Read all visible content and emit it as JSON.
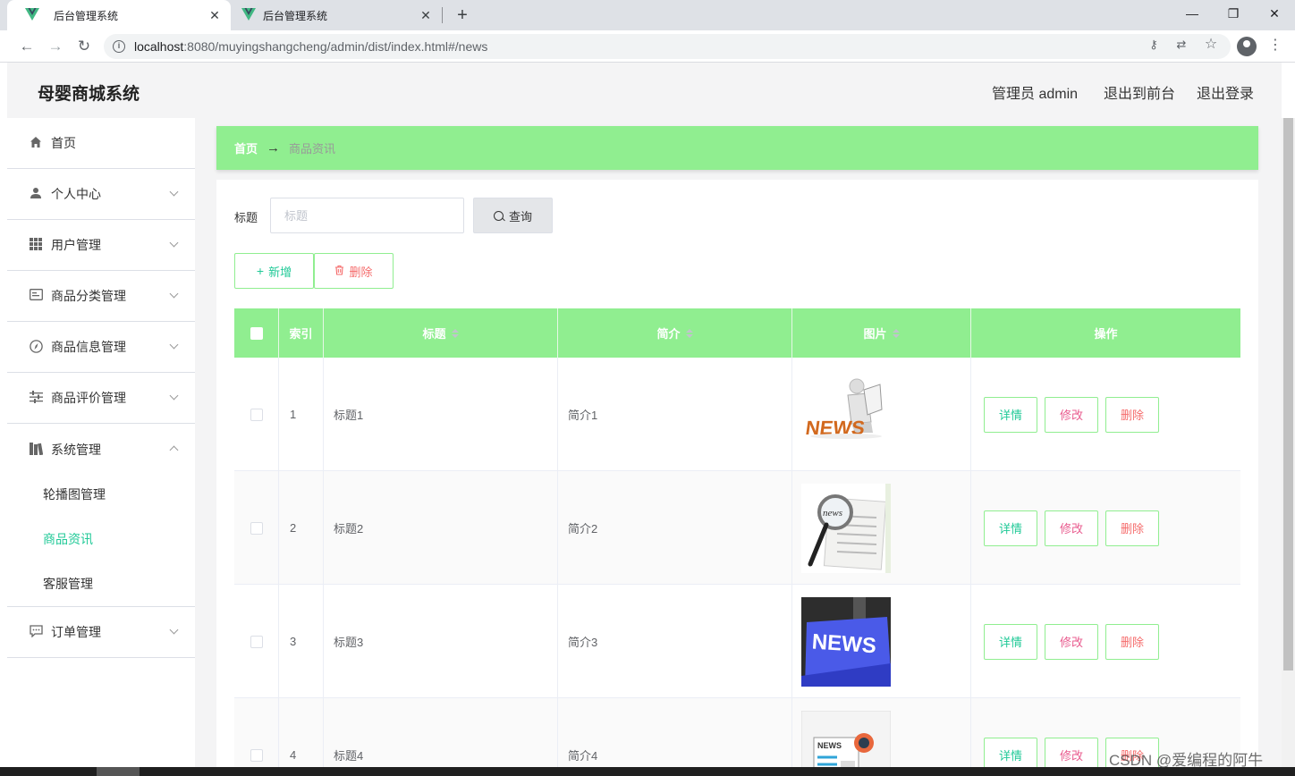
{
  "browser": {
    "tabs": [
      {
        "title": "后台管理系统",
        "close": "✕"
      },
      {
        "title": "后台管理系统",
        "close": "✕"
      }
    ],
    "new_tab": "+",
    "window_controls": {
      "minimize": "—",
      "restore": "❐",
      "close": "✕"
    },
    "url_host": "localhost",
    "url_rest": ":8080/muyingshangcheng/admin/dist/index.html#/news",
    "icons": [
      "back-icon",
      "forward-icon",
      "reload-icon",
      "info-icon",
      "key-icon",
      "translate-icon",
      "star-icon",
      "profile-icon",
      "menu-icon"
    ]
  },
  "header": {
    "title": "母婴商城系统",
    "user": "管理员 admin",
    "front": "退出到前台",
    "logout": "退出登录"
  },
  "sidebar": {
    "items": [
      {
        "label": "首页",
        "icon": "home-icon"
      },
      {
        "label": "个人中心",
        "icon": "user-icon"
      },
      {
        "label": "用户管理",
        "icon": "grid-icon"
      },
      {
        "label": "商品分类管理",
        "icon": "card-icon"
      },
      {
        "label": "商品信息管理",
        "icon": "compass-icon"
      },
      {
        "label": "商品评价管理",
        "icon": "sliders-icon"
      },
      {
        "label": "系统管理",
        "icon": "books-icon"
      },
      {
        "label": "订单管理",
        "icon": "chat-icon"
      }
    ],
    "submenu": [
      {
        "label": "轮播图管理"
      },
      {
        "label": "商品资讯"
      },
      {
        "label": "客服管理"
      }
    ]
  },
  "breadcrumb": {
    "home": "首页",
    "arrow": "→",
    "current": "商品资讯"
  },
  "search": {
    "label": "标题",
    "placeholder": "标题",
    "button": "查询"
  },
  "actions": {
    "add": "新增",
    "delete": "删除"
  },
  "table": {
    "headers": {
      "index": "索引",
      "title": "标题",
      "intro": "简介",
      "image": "图片",
      "ops": "操作"
    },
    "rows": [
      {
        "index": "1",
        "title": "标题1",
        "intro": "简介1",
        "image": "news-reader-figure"
      },
      {
        "index": "2",
        "title": "标题2",
        "intro": "简介2",
        "image": "news-magnifier"
      },
      {
        "index": "3",
        "title": "标题3",
        "intro": "简介3",
        "image": "news-key"
      },
      {
        "index": "4",
        "title": "标题4",
        "intro": "简介4",
        "image": "news-paper"
      }
    ],
    "row_buttons": {
      "detail": "详情",
      "edit": "修改",
      "remove": "删除"
    }
  },
  "watermark": "CSDN @爱编程的阿牛",
  "colors": {
    "accent_green": "#90ee90",
    "teal": "#20c997",
    "pink": "#e95c8f",
    "danger": "#f56c6c"
  }
}
